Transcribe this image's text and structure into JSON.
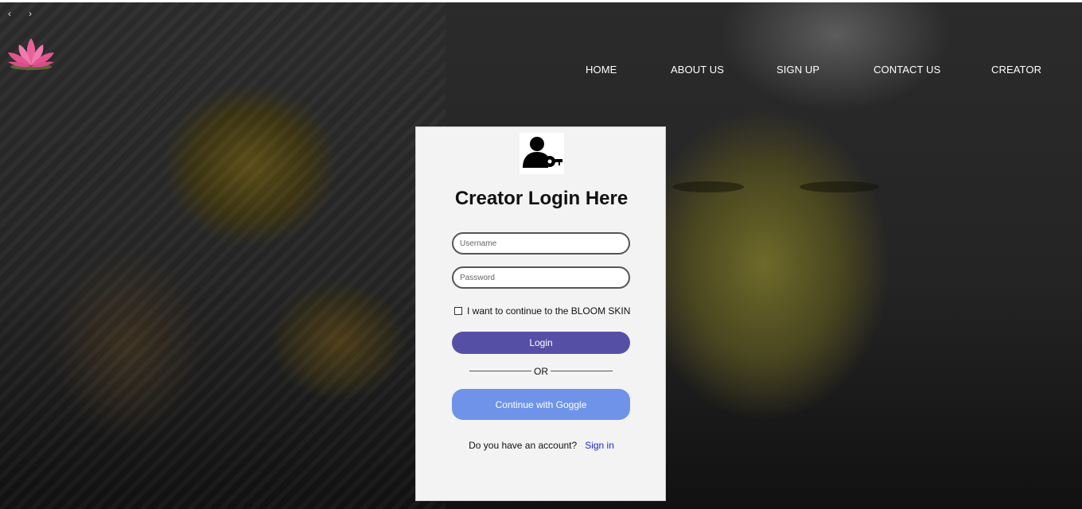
{
  "browser": {
    "back": "‹",
    "forward": "›"
  },
  "nav": {
    "items": [
      {
        "label": "HOME"
      },
      {
        "label": "ABOUT US"
      },
      {
        "label": "SIGN UP"
      },
      {
        "label": "CONTACT US"
      },
      {
        "label": "CREATOR"
      }
    ]
  },
  "login": {
    "icon": "user-key-icon",
    "title": "Creator Login Here",
    "username_placeholder": "Username",
    "password_placeholder": "Password",
    "checkbox_label": "I want to continue to the BLOOM SKIN",
    "login_button": "Login",
    "or_text": "OR",
    "google_button": "Continue with Goggle",
    "account_question": "Do you have an account?",
    "signin_link": "Sign in"
  },
  "logo": {
    "icon": "lotus-icon",
    "color": "#e8619a"
  },
  "colors": {
    "login_button": "#5550a6",
    "google_button": "#6f93e8",
    "signin_link": "#2222dd",
    "card_bg": "#f3f3f3"
  }
}
